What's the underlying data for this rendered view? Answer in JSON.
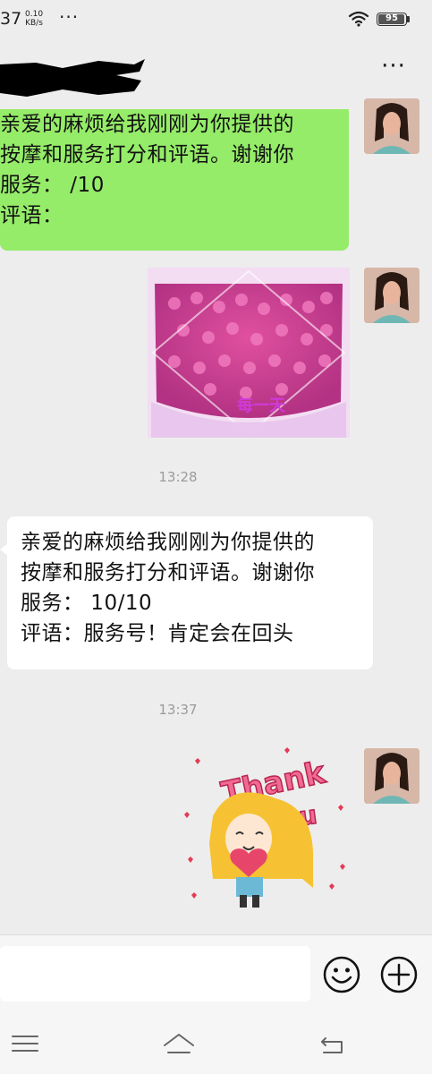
{
  "status_bar": {
    "time": "37",
    "net_speed_value": "0.10",
    "net_speed_unit": "KB/s",
    "overflow": "···",
    "battery_level": "95",
    "icons": [
      "wifi-icon",
      "battery-icon"
    ]
  },
  "header": {
    "title_redacted": true,
    "more_label": "···"
  },
  "messages": [
    {
      "side": "right",
      "type": "text",
      "lines": [
        "亲爱的麻烦给我刚刚为你提供的",
        "按摩和服务打分和评语。谢谢你",
        "服务：  /10",
        "评语："
      ]
    },
    {
      "side": "right",
      "type": "image",
      "image_caption": "每一天"
    },
    {
      "type": "timestamp",
      "text": "13:28"
    },
    {
      "side": "left",
      "type": "text",
      "lines": [
        "亲爱的麻烦给我刚刚为你提供的",
        "按摩和服务打分和评语。谢谢你",
        "服务：  10/10",
        "评语：服务号！肯定会在回头"
      ]
    },
    {
      "type": "timestamp",
      "text": "13:37"
    },
    {
      "side": "right",
      "type": "sticker",
      "sticker_line1": "Thank",
      "sticker_line2": "You"
    }
  ],
  "input_bar": {
    "value": "",
    "icons": [
      "emoji-icon",
      "plus-icon"
    ]
  },
  "nav_bar": {
    "icons": [
      "menu-icon",
      "home-icon",
      "back-icon"
    ]
  },
  "colors": {
    "chat_background": "#ededed",
    "sent_bubble": "#95ec69",
    "received_bubble": "#ffffff",
    "timestamp": "#9b9b9b",
    "sticker_text": "#e8457c"
  }
}
